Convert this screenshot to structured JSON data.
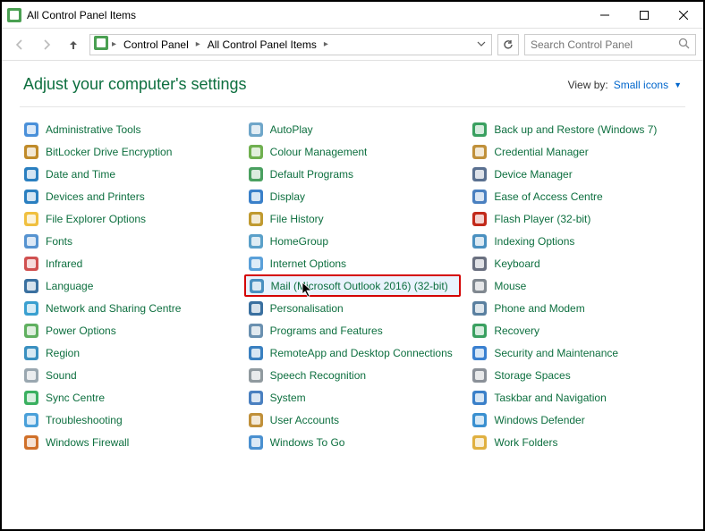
{
  "window": {
    "title": "All Control Panel Items"
  },
  "breadcrumb": {
    "root": "Control Panel",
    "current": "All Control Panel Items"
  },
  "search": {
    "placeholder": "Search Control Panel"
  },
  "header": {
    "title": "Adjust your computer's settings",
    "viewby_label": "View by:",
    "viewby_value": "Small icons"
  },
  "items": [
    {
      "label": "Administrative Tools",
      "icon": "tools",
      "c": "#4a90d9"
    },
    {
      "label": "BitLocker Drive Encryption",
      "icon": "lock",
      "c": "#c08b2a"
    },
    {
      "label": "Date and Time",
      "icon": "clock",
      "c": "#2a7fc0"
    },
    {
      "label": "Devices and Printers",
      "icon": "printer",
      "c": "#2a7fc0"
    },
    {
      "label": "File Explorer Options",
      "icon": "folder",
      "c": "#f0c040"
    },
    {
      "label": "Fonts",
      "icon": "font",
      "c": "#5693d0"
    },
    {
      "label": "Infrared",
      "icon": "ir",
      "c": "#d05050"
    },
    {
      "label": "Language",
      "icon": "lang",
      "c": "#3a70a0"
    },
    {
      "label": "Network and Sharing Centre",
      "icon": "net",
      "c": "#3aa0d0"
    },
    {
      "label": "Power Options",
      "icon": "power",
      "c": "#60b060"
    },
    {
      "label": "Region",
      "icon": "globe",
      "c": "#3a90c0"
    },
    {
      "label": "Sound",
      "icon": "sound",
      "c": "#9aa7b0"
    },
    {
      "label": "Sync Centre",
      "icon": "sync",
      "c": "#3ab060"
    },
    {
      "label": "Troubleshooting",
      "icon": "trouble",
      "c": "#4aa0d9"
    },
    {
      "label": "Windows Firewall",
      "icon": "fire",
      "c": "#d0702a"
    },
    {
      "label": "AutoPlay",
      "icon": "cd",
      "c": "#6fa6c9"
    },
    {
      "label": "Colour Management",
      "icon": "colors",
      "c": "#70b050"
    },
    {
      "label": "Default Programs",
      "icon": "defprog",
      "c": "#4aa060"
    },
    {
      "label": "Display",
      "icon": "display",
      "c": "#3a80c9"
    },
    {
      "label": "File History",
      "icon": "filehist",
      "c": "#c09a30"
    },
    {
      "label": "HomeGroup",
      "icon": "home",
      "c": "#5aa0c9"
    },
    {
      "label": "Internet Options",
      "icon": "ie",
      "c": "#5aa0d9"
    },
    {
      "label": "Mail (Microsoft Outlook 2016) (32-bit)",
      "icon": "mail",
      "c": "#4a90c0",
      "highlight": true
    },
    {
      "label": "Personalisation",
      "icon": "pers",
      "c": "#3a70a0"
    },
    {
      "label": "Programs and Features",
      "icon": "prog",
      "c": "#6a90b0"
    },
    {
      "label": "RemoteApp and Desktop Connections",
      "icon": "remote",
      "c": "#3a80c0"
    },
    {
      "label": "Speech Recognition",
      "icon": "mic",
      "c": "#909a9f"
    },
    {
      "label": "System",
      "icon": "system",
      "c": "#4a80c0"
    },
    {
      "label": "User Accounts",
      "icon": "users",
      "c": "#c0903a"
    },
    {
      "label": "Windows To Go",
      "icon": "wtg",
      "c": "#4a90d0"
    },
    {
      "label": "Back up and Restore (Windows 7)",
      "icon": "backup",
      "c": "#3aa060"
    },
    {
      "label": "Credential Manager",
      "icon": "cred",
      "c": "#c0903a"
    },
    {
      "label": "Device Manager",
      "icon": "devmgr",
      "c": "#5a7090"
    },
    {
      "label": "Ease of Access Centre",
      "icon": "ease",
      "c": "#4a80c0"
    },
    {
      "label": "Flash Player (32-bit)",
      "icon": "flash",
      "c": "#c22a1a"
    },
    {
      "label": "Indexing Options",
      "icon": "index",
      "c": "#4a90c0"
    },
    {
      "label": "Keyboard",
      "icon": "kb",
      "c": "#6a7080"
    },
    {
      "label": "Mouse",
      "icon": "mouse",
      "c": "#808890"
    },
    {
      "label": "Phone and Modem",
      "icon": "phone",
      "c": "#5a80a0"
    },
    {
      "label": "Recovery",
      "icon": "recov",
      "c": "#3aa060"
    },
    {
      "label": "Security and Maintenance",
      "icon": "sec",
      "c": "#3a80d0"
    },
    {
      "label": "Storage Spaces",
      "icon": "storage",
      "c": "#8a9098"
    },
    {
      "label": "Taskbar and Navigation",
      "icon": "task",
      "c": "#3a80c9"
    },
    {
      "label": "Windows Defender",
      "icon": "defender",
      "c": "#3a90d0"
    },
    {
      "label": "Work Folders",
      "icon": "work",
      "c": "#e0b040"
    }
  ],
  "grid": {
    "rows": 15,
    "cols": 3
  }
}
